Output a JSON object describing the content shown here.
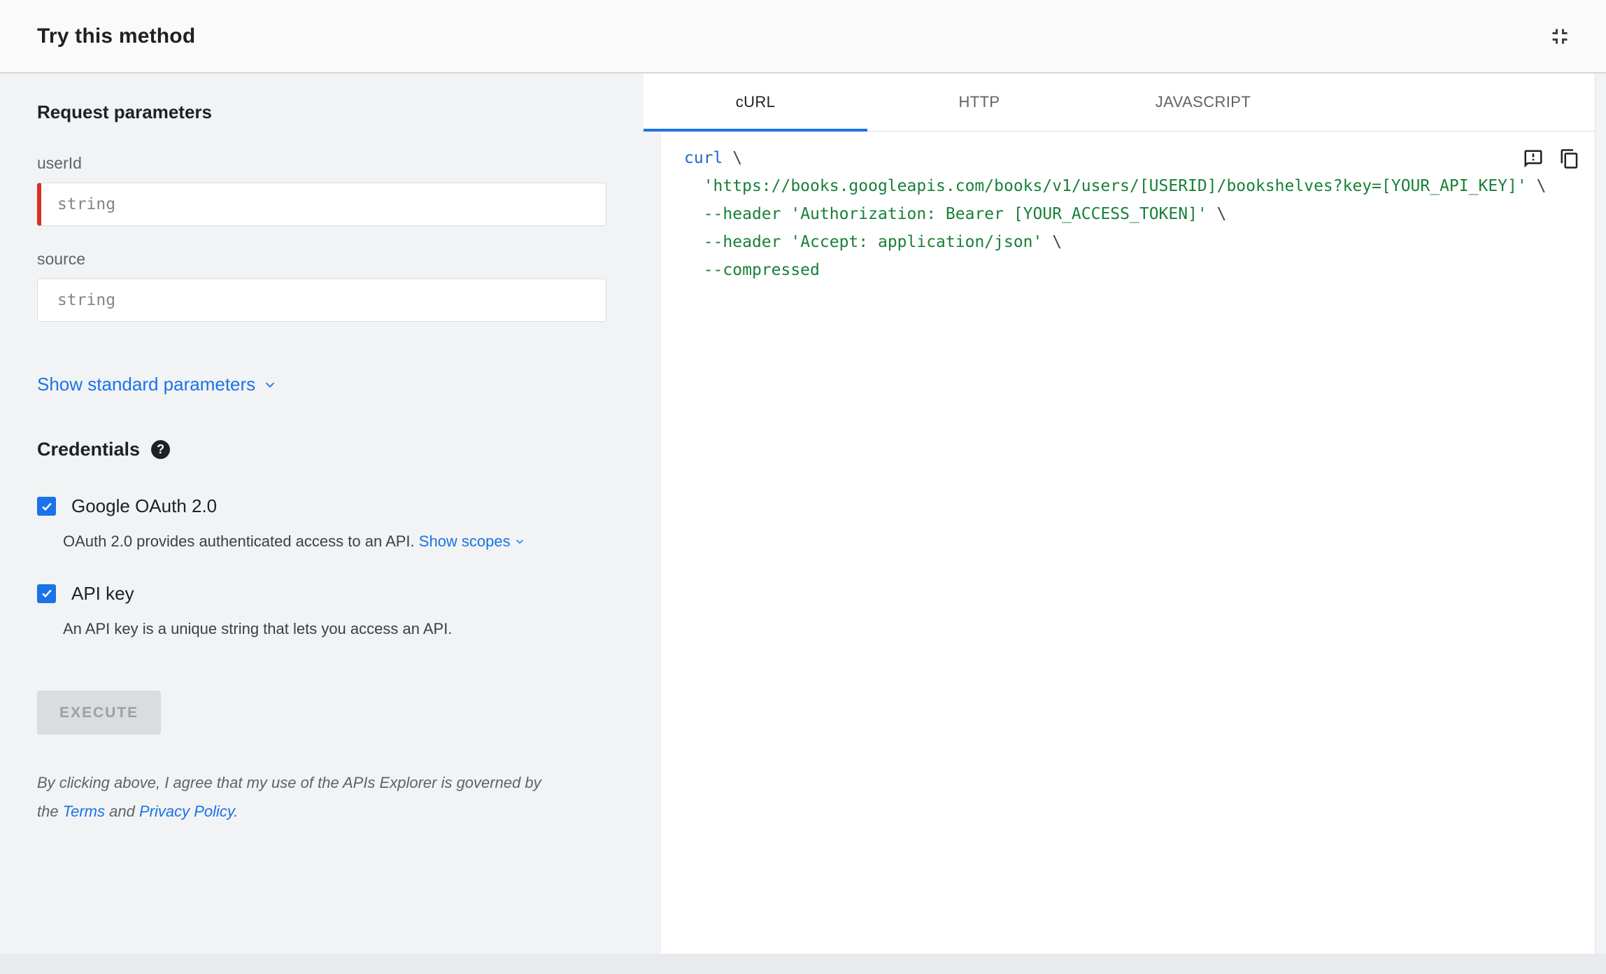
{
  "header": {
    "title": "Try this method"
  },
  "left": {
    "request_heading": "Request parameters",
    "fields": [
      {
        "label": "userId",
        "placeholder": "string",
        "required": true
      },
      {
        "label": "source",
        "placeholder": "string",
        "required": false
      }
    ],
    "show_standard_label": "Show standard parameters",
    "credentials_heading": "Credentials",
    "help_glyph": "?",
    "oauth": {
      "label": "Google OAuth 2.0",
      "checked": true,
      "description": "OAuth 2.0 provides authenticated access to an API.",
      "scopes_link": "Show scopes"
    },
    "api_key": {
      "label": "API key",
      "checked": true,
      "description": "An API key is a unique string that lets you access an API."
    },
    "execute_label": "EXECUTE",
    "disclaimer": {
      "line1": "By clicking above, I agree that my use of the APIs Explorer is governed by",
      "line2_pre": "the ",
      "terms": "Terms",
      "mid": " and ",
      "privacy": "Privacy Policy",
      "post": "."
    }
  },
  "tabs": [
    {
      "label": "cURL",
      "active": true
    },
    {
      "label": "HTTP",
      "active": false
    },
    {
      "label": "JAVASCRIPT",
      "active": false
    }
  ],
  "code": {
    "lines": [
      {
        "tokens": [
          {
            "t": "curl",
            "c": "kw"
          },
          {
            "t": " \\",
            "c": "plain"
          }
        ]
      },
      {
        "tokens": [
          {
            "t": "  ",
            "c": "plain"
          },
          {
            "t": "'https://books.googleapis.com/books/v1/users/[USERID]/bookshelves?key=[YOUR_API_KEY]'",
            "c": "str"
          },
          {
            "t": " \\",
            "c": "plain"
          }
        ]
      },
      {
        "tokens": [
          {
            "t": "  ",
            "c": "plain"
          },
          {
            "t": "--header",
            "c": "flag"
          },
          {
            "t": " ",
            "c": "plain"
          },
          {
            "t": "'Authorization: Bearer [YOUR_ACCESS_TOKEN]'",
            "c": "str"
          },
          {
            "t": " \\",
            "c": "plain"
          }
        ]
      },
      {
        "tokens": [
          {
            "t": "  ",
            "c": "plain"
          },
          {
            "t": "--header",
            "c": "flag"
          },
          {
            "t": " ",
            "c": "plain"
          },
          {
            "t": "'Accept: application/json'",
            "c": "str"
          },
          {
            "t": " \\",
            "c": "plain"
          }
        ]
      },
      {
        "tokens": [
          {
            "t": "  ",
            "c": "plain"
          },
          {
            "t": "--compressed",
            "c": "flag"
          }
        ]
      }
    ]
  },
  "icons": {
    "fullscreen_exit": "fullscreen-exit-icon",
    "help": "help-icon",
    "chevron_down": "chevron-down-icon",
    "checkmark": "checkmark-icon",
    "feedback": "feedback-icon",
    "copy": "copy-icon"
  },
  "colors": {
    "accent_blue": "#1a73e8",
    "required_red": "#d93025",
    "left_panel_bg": "#f1f3f4",
    "header_bg": "#fafafa",
    "code_keyword": "#1967d2",
    "code_string": "#188038",
    "code_plain": "#37474f",
    "checkbox_blue": "#1a73e8",
    "disabled_button_bg": "#dadce0",
    "disabled_button_text": "#9aa0a6"
  }
}
